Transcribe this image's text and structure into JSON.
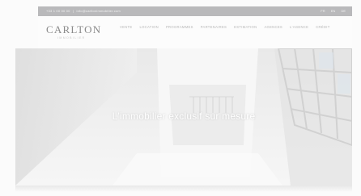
{
  "topbar": {
    "phone": "+33 1 00 00 00",
    "separator": "|",
    "email": "info@carltonimmobilier.com",
    "languages": [
      "FR",
      "EN",
      "DE"
    ]
  },
  "logo": {
    "name": "CARLTON",
    "tagline": "IMMOBILIER"
  },
  "nav": {
    "items": [
      "VENTE",
      "LOCATION",
      "PROGRAMMES",
      "PARTENAIRES",
      "ESTIMATION",
      "AGENCES",
      "L'AGENCE",
      "CRÉDIT"
    ]
  },
  "hero": {
    "title": "L'immobilier exclusif sur mesure"
  }
}
